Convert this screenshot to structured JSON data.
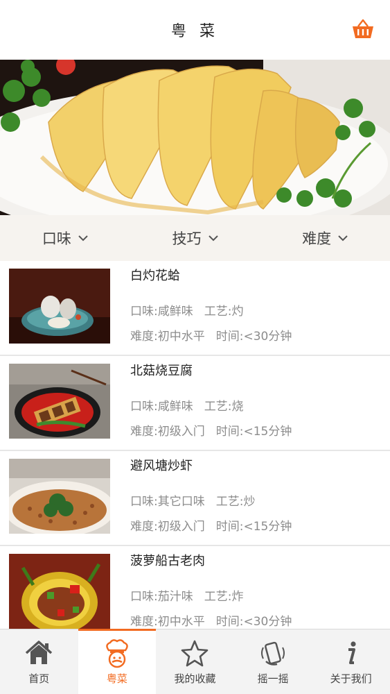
{
  "header": {
    "title": "粤 菜",
    "cart_icon": "shopping-basket-icon"
  },
  "banner": {
    "image": "white-cut-chicken-photo"
  },
  "filters": [
    {
      "label": "口味",
      "icon": "chevron-down-icon"
    },
    {
      "label": "技巧",
      "icon": "chevron-down-icon"
    },
    {
      "label": "难度",
      "icon": "chevron-down-icon"
    }
  ],
  "recipes": [
    {
      "name": "白灼花蛤",
      "taste": "口味:咸鲜味",
      "craft": "工艺:灼",
      "difficulty": "难度:初中水平",
      "time": "时间:<30分钟"
    },
    {
      "name": "北菇烧豆腐",
      "taste": "口味:咸鲜味",
      "craft": "工艺:烧",
      "difficulty": "难度:初级入门",
      "time": "时间:<15分钟"
    },
    {
      "name": "避风塘炒虾",
      "taste": "口味:其它口味",
      "craft": "工艺:炒",
      "difficulty": "难度:初级入门",
      "time": "时间:<15分钟"
    },
    {
      "name": "菠萝船古老肉",
      "taste": "口味:茄汁味",
      "craft": "工艺:炸",
      "difficulty": "难度:初中水平",
      "time": "时间:<30分钟"
    }
  ],
  "tabs": [
    {
      "label": "首页",
      "icon": "home-icon",
      "active": false
    },
    {
      "label": "粤菜",
      "icon": "chef-icon",
      "active": true
    },
    {
      "label": "我的收藏",
      "icon": "star-icon",
      "active": false
    },
    {
      "label": "摇一摇",
      "icon": "shake-phone-icon",
      "active": false
    },
    {
      "label": "关于我们",
      "icon": "info-icon",
      "active": false
    }
  ],
  "colors": {
    "accent": "#f26b21",
    "filter_bg": "#f6f3ef",
    "meta_text": "#8c8c8c"
  }
}
